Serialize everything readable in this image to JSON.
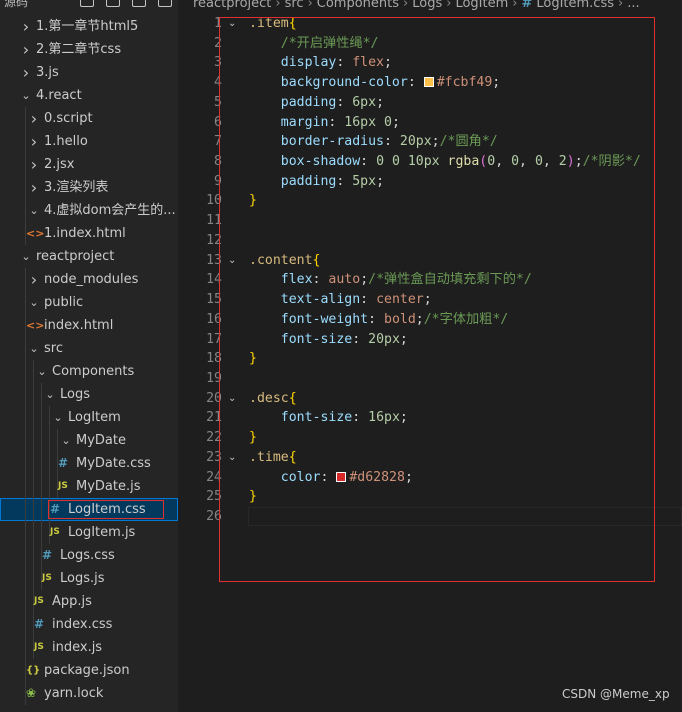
{
  "sidebar": {
    "title": "源码",
    "items": [
      {
        "label": "1.第一章节html5",
        "depth": 0,
        "kind": "folder-closed"
      },
      {
        "label": "2.第二章节css",
        "depth": 0,
        "kind": "folder-closed"
      },
      {
        "label": "3.js",
        "depth": 0,
        "kind": "folder-closed"
      },
      {
        "label": "4.react",
        "depth": 0,
        "kind": "folder-open"
      },
      {
        "label": "0.script",
        "depth": 1,
        "kind": "folder-closed",
        "hover": true
      },
      {
        "label": "1.hello",
        "depth": 1,
        "kind": "folder-closed"
      },
      {
        "label": "2.jsx",
        "depth": 1,
        "kind": "folder-closed"
      },
      {
        "label": "3.渲染列表",
        "depth": 1,
        "kind": "folder-closed"
      },
      {
        "label": "4.虚拟dom会产生的...",
        "depth": 1,
        "kind": "folder-open"
      },
      {
        "label": "1.index.html",
        "depth": 1,
        "kind": "html"
      },
      {
        "label": "reactproject",
        "depth": 0,
        "kind": "folder-open"
      },
      {
        "label": "node_modules",
        "depth": 1,
        "kind": "folder-closed"
      },
      {
        "label": "public",
        "depth": 1,
        "kind": "folder-open"
      },
      {
        "label": "index.html",
        "depth": 1,
        "kind": "html"
      },
      {
        "label": "src",
        "depth": 1,
        "kind": "folder-open"
      },
      {
        "label": "Components",
        "depth": 2,
        "kind": "folder-open"
      },
      {
        "label": "Logs",
        "depth": 3,
        "kind": "folder-open"
      },
      {
        "label": "LogItem",
        "depth": 4,
        "kind": "folder-open"
      },
      {
        "label": "MyDate",
        "depth": 5,
        "kind": "folder-open"
      },
      {
        "label": "MyDate.css",
        "depth": 5,
        "kind": "css"
      },
      {
        "label": "MyDate.js",
        "depth": 5,
        "kind": "js"
      },
      {
        "label": "LogItem.css",
        "depth": 4,
        "kind": "css",
        "selected": true
      },
      {
        "label": "LogItem.js",
        "depth": 4,
        "kind": "js"
      },
      {
        "label": "Logs.css",
        "depth": 3,
        "kind": "css"
      },
      {
        "label": "Logs.js",
        "depth": 3,
        "kind": "js"
      },
      {
        "label": "App.js",
        "depth": 2,
        "kind": "js"
      },
      {
        "label": "index.css",
        "depth": 2,
        "kind": "css"
      },
      {
        "label": "index.js",
        "depth": 2,
        "kind": "js"
      },
      {
        "label": "package.json",
        "depth": 1,
        "kind": "json"
      },
      {
        "label": "yarn.lock",
        "depth": 1,
        "kind": "lock"
      }
    ]
  },
  "breadcrumb": [
    "reactproject",
    "src",
    "Components",
    "Logs",
    "LogItem",
    "LogItem.css",
    "..."
  ],
  "icons": {
    "css": "#",
    "js": "JS",
    "html": "<>",
    "json": "{}",
    "lock": "yarn-icon"
  },
  "editor": {
    "lines": [
      [
        {
          "t": ".item",
          "c": "sel"
        },
        {
          "t": "{",
          "c": "br"
        }
      ],
      [
        {
          "t": "    "
        },
        {
          "t": "/*开启弹性绳*/",
          "c": "cmt"
        }
      ],
      [
        {
          "t": "    "
        },
        {
          "t": "display",
          "c": "prop"
        },
        {
          "t": ": ",
          "c": "p"
        },
        {
          "t": "flex",
          "c": "val"
        },
        {
          "t": ";",
          "c": "p"
        }
      ],
      [
        {
          "t": "    "
        },
        {
          "t": "background-color",
          "c": "prop"
        },
        {
          "t": ": ",
          "c": "p"
        },
        {
          "swatch": "#fcbf49"
        },
        {
          "t": "#fcbf49",
          "c": "val"
        },
        {
          "t": ";",
          "c": "p"
        }
      ],
      [
        {
          "t": "    "
        },
        {
          "t": "padding",
          "c": "prop"
        },
        {
          "t": ": ",
          "c": "p"
        },
        {
          "t": "6px",
          "c": "num"
        },
        {
          "t": ";",
          "c": "p"
        }
      ],
      [
        {
          "t": "    "
        },
        {
          "t": "margin",
          "c": "prop"
        },
        {
          "t": ": ",
          "c": "p"
        },
        {
          "t": "16px 0",
          "c": "num"
        },
        {
          "t": ";",
          "c": "p"
        }
      ],
      [
        {
          "t": "    "
        },
        {
          "t": "border-radius",
          "c": "prop"
        },
        {
          "t": ": ",
          "c": "p"
        },
        {
          "t": "20px",
          "c": "num"
        },
        {
          "t": ";",
          "c": "p"
        },
        {
          "t": "/*圆角*/",
          "c": "cmt"
        }
      ],
      [
        {
          "t": "    "
        },
        {
          "t": "box-shadow",
          "c": "prop"
        },
        {
          "t": ": ",
          "c": "p"
        },
        {
          "t": "0 0 10px ",
          "c": "num"
        },
        {
          "t": "rgba",
          "c": "fn"
        },
        {
          "t": "(",
          "c": "br2"
        },
        {
          "t": "0",
          "c": "num"
        },
        {
          "t": ", ",
          "c": "p"
        },
        {
          "t": "0",
          "c": "num"
        },
        {
          "t": ", ",
          "c": "p"
        },
        {
          "t": "0",
          "c": "num"
        },
        {
          "t": ", ",
          "c": "p"
        },
        {
          "t": "2",
          "c": "num"
        },
        {
          "t": ")",
          "c": "br2"
        },
        {
          "t": ";",
          "c": "p"
        },
        {
          "t": "/*阴影*/",
          "c": "cmt"
        }
      ],
      [
        {
          "t": "    "
        },
        {
          "t": "padding",
          "c": "prop"
        },
        {
          "t": ": ",
          "c": "p"
        },
        {
          "t": "5px",
          "c": "num"
        },
        {
          "t": ";",
          "c": "p"
        }
      ],
      [
        {
          "t": "}",
          "c": "br"
        }
      ],
      [],
      [],
      [
        {
          "t": ".content",
          "c": "sel"
        },
        {
          "t": "{",
          "c": "br"
        }
      ],
      [
        {
          "t": "    "
        },
        {
          "t": "flex",
          "c": "prop"
        },
        {
          "t": ": ",
          "c": "p"
        },
        {
          "t": "auto",
          "c": "val"
        },
        {
          "t": ";",
          "c": "p"
        },
        {
          "t": "/*弹性盒自动填充剩下的*/",
          "c": "cmt"
        }
      ],
      [
        {
          "t": "    "
        },
        {
          "t": "text-align",
          "c": "prop"
        },
        {
          "t": ": ",
          "c": "p"
        },
        {
          "t": "center",
          "c": "val"
        },
        {
          "t": ";",
          "c": "p"
        }
      ],
      [
        {
          "t": "    "
        },
        {
          "t": "font-weight",
          "c": "prop"
        },
        {
          "t": ": ",
          "c": "p"
        },
        {
          "t": "bold",
          "c": "val"
        },
        {
          "t": ";",
          "c": "p"
        },
        {
          "t": "/*字体加粗*/",
          "c": "cmt"
        }
      ],
      [
        {
          "t": "    "
        },
        {
          "t": "font-size",
          "c": "prop"
        },
        {
          "t": ": ",
          "c": "p"
        },
        {
          "t": "20px",
          "c": "num"
        },
        {
          "t": ";",
          "c": "p"
        }
      ],
      [
        {
          "t": "}",
          "c": "br"
        }
      ],
      [],
      [
        {
          "t": ".desc",
          "c": "sel"
        },
        {
          "t": "{",
          "c": "br"
        }
      ],
      [
        {
          "t": "    "
        },
        {
          "t": "font-size",
          "c": "prop"
        },
        {
          "t": ": ",
          "c": "p"
        },
        {
          "t": "16px",
          "c": "num"
        },
        {
          "t": ";",
          "c": "p"
        }
      ],
      [
        {
          "t": "}",
          "c": "br"
        }
      ],
      [
        {
          "t": ".time",
          "c": "sel"
        },
        {
          "t": "{",
          "c": "br"
        }
      ],
      [
        {
          "t": "    "
        },
        {
          "t": "color",
          "c": "prop"
        },
        {
          "t": ": ",
          "c": "p"
        },
        {
          "swatch": "#d62828"
        },
        {
          "t": "#d62828",
          "c": "val"
        },
        {
          "t": ";",
          "c": "p"
        }
      ],
      [
        {
          "t": "}",
          "c": "br"
        }
      ],
      []
    ],
    "fold_lines": [
      1,
      13,
      20,
      23
    ],
    "current_line": 26
  },
  "watermark": "CSDN @Meme_xp",
  "colors": {
    "annotation": "#e03131",
    "selection": "#04395e"
  }
}
